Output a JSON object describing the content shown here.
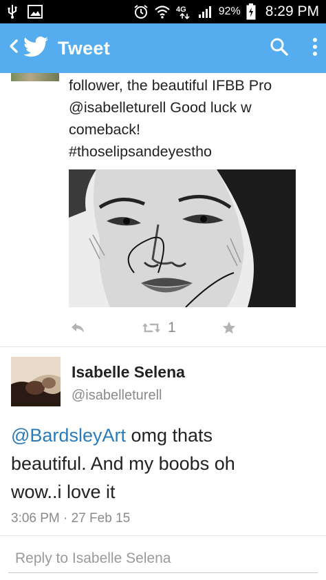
{
  "status_bar": {
    "battery_percent": "92%",
    "time": "8:29 PM",
    "network": "4G",
    "icons": [
      "usb-icon",
      "image-icon",
      "alarm-icon",
      "wifi-icon",
      "network-4g-icon",
      "signal-icon",
      "battery-charging-icon"
    ]
  },
  "app_bar": {
    "title": "Tweet",
    "color": "#55acee",
    "icons": [
      "back-chevron-icon",
      "twitter-bird-icon",
      "search-icon",
      "overflow-menu-icon"
    ]
  },
  "previous_tweet": {
    "text_lines": [
      "follower, the beautiful IFBB Pro",
      "@isabelleturell Good luck w",
      "comeback!",
      "#thoselipsandeyestho"
    ],
    "retweet_count": "1"
  },
  "tweet": {
    "author_name": "Isabelle Selena",
    "author_handle": "@isabelleturell",
    "mention": "@BardsleyArt",
    "body_line1_rest": " omg thats",
    "body_line2": "beautiful. And my boobs oh",
    "body_line3": "wow..i love it",
    "timestamp": "3:06 PM · 27 Feb 15"
  },
  "reply": {
    "placeholder": "Reply to Isabelle Selena"
  },
  "colors": {
    "link": "#2b7bb9",
    "secondary_text": "#8a8a8a",
    "action_icons": "#b3b3b3"
  }
}
